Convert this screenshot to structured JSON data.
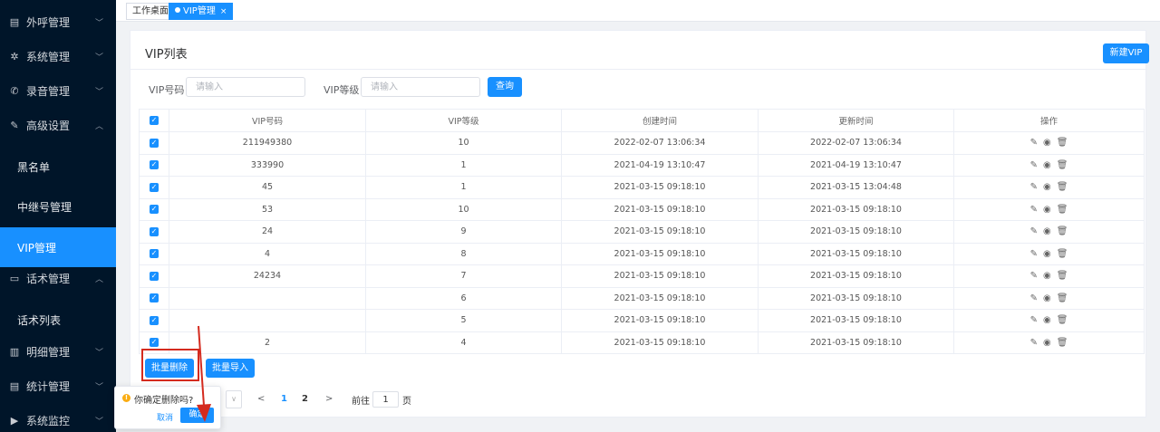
{
  "sidebar": {
    "items": [
      {
        "label": "外呼管理",
        "icon": "document-icon"
      },
      {
        "label": "系统管理",
        "icon": "gear-icon"
      },
      {
        "label": "录音管理",
        "icon": "phone-icon"
      },
      {
        "label": "高级设置",
        "icon": "edit-icon"
      },
      {
        "label": "黑名单"
      },
      {
        "label": "中继号管理"
      },
      {
        "label": "VIP管理"
      },
      {
        "label": "话术管理",
        "icon": "chat-icon"
      },
      {
        "label": "话术列表"
      },
      {
        "label": "明细管理",
        "icon": "book-icon"
      },
      {
        "label": "统计管理",
        "icon": "document-icon"
      },
      {
        "label": "系统监控",
        "icon": "video-icon"
      }
    ],
    "active_color": "#1890ff",
    "bg_color": "#001529"
  },
  "tabs": [
    {
      "label": "工作桌面"
    },
    {
      "label": "VIP管理",
      "close": "×"
    }
  ],
  "card": {
    "title": "VIP列表",
    "new_button": "新建VIP"
  },
  "search": {
    "vip_no_label": "VIP号码",
    "vip_no_placeholder": "请输入",
    "vip_level_label": "VIP等级",
    "vip_level_placeholder": "请输入",
    "query_button": "查询"
  },
  "table": {
    "columns": [
      "VIP号码",
      "VIP等级",
      "创建时间",
      "更新时间",
      "操作"
    ],
    "rows": [
      {
        "vip": "211949380",
        "level": "10",
        "created": "2022-02-07 13:06:34",
        "updated": "2022-02-07 13:06:34"
      },
      {
        "vip": "333990",
        "level": "1",
        "created": "2021-04-19 13:10:47",
        "updated": "2021-04-19 13:10:47"
      },
      {
        "vip": "45",
        "level": "1",
        "created": "2021-03-15 09:18:10",
        "updated": "2021-03-15 13:04:48"
      },
      {
        "vip": "53",
        "level": "10",
        "created": "2021-03-15 09:18:10",
        "updated": "2021-03-15 09:18:10"
      },
      {
        "vip": "24",
        "level": "9",
        "created": "2021-03-15 09:18:10",
        "updated": "2021-03-15 09:18:10"
      },
      {
        "vip": "4",
        "level": "8",
        "created": "2021-03-15 09:18:10",
        "updated": "2021-03-15 09:18:10"
      },
      {
        "vip": "24234",
        "level": "7",
        "created": "2021-03-15 09:18:10",
        "updated": "2021-03-15 09:18:10"
      },
      {
        "vip": "",
        "level": "6",
        "created": "2021-03-15 09:18:10",
        "updated": "2021-03-15 09:18:10"
      },
      {
        "vip": "",
        "level": "5",
        "created": "2021-03-15 09:18:10",
        "updated": "2021-03-15 09:18:10"
      },
      {
        "vip": "2",
        "level": "4",
        "created": "2021-03-15 09:18:10",
        "updated": "2021-03-15 09:18:10"
      }
    ]
  },
  "actions": {
    "batch_delete": "批量删除",
    "batch_import": "批量导入"
  },
  "pagination": {
    "prev": "<",
    "pages": [
      "1",
      "2"
    ],
    "current": "1",
    "next": ">",
    "goto_label": "前往",
    "goto_value": "1",
    "page_suffix": "页"
  },
  "popconfirm": {
    "message": "你确定删除吗?",
    "cancel": "取消",
    "confirm": "确定"
  },
  "colors": {
    "primary": "#1890ff",
    "annotation_red": "#d42b1f",
    "warning": "#faad14"
  }
}
